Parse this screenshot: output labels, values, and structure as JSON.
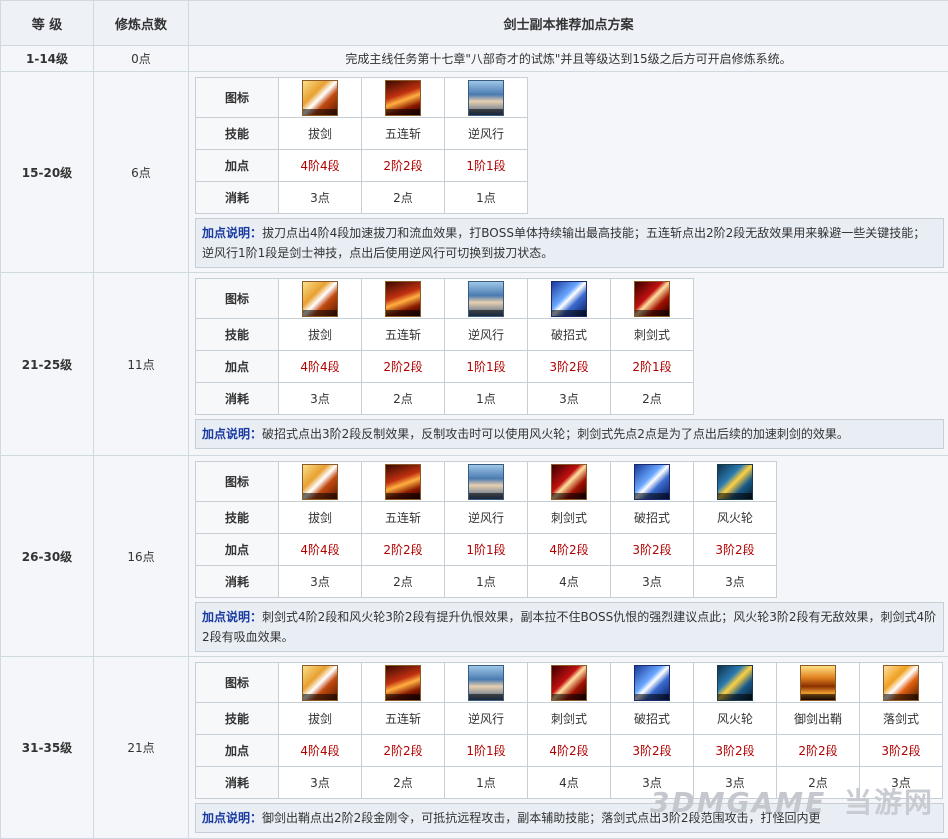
{
  "headers": {
    "level": "等 级",
    "points": "修炼点数",
    "plan": "剑士副本推荐加点方案"
  },
  "row_labels": {
    "icon": "图标",
    "skill": "技能",
    "add": "加点",
    "cost": "消耗"
  },
  "note_label": "加点说明：",
  "first_row": {
    "level": "1-14级",
    "points": "0点",
    "text": "完成主线任务第十七章\"八部奇才的试炼\"并且等级达到15级之后方可开启修炼系统。"
  },
  "sections": [
    {
      "level": "15-20级",
      "points": "6点",
      "skills": [
        {
          "icon": "sword-icon",
          "name": "拔剑",
          "add": "4阶4段",
          "cost": "3点"
        },
        {
          "icon": "combo-icon",
          "name": "五连斩",
          "add": "2阶2段",
          "cost": "2点"
        },
        {
          "icon": "wind-icon",
          "name": "逆风行",
          "add": "1阶1段",
          "cost": "1点"
        }
      ],
      "note": "拔刀点出4阶4段加速拔刀和流血效果，打BOSS单体持续输出最高技能；五连斩点出2阶2段无敌效果用来躲避一些关键技能；逆风行1阶1段是剑士神技，点出后使用逆风行可切换到拔刀状态。"
    },
    {
      "level": "21-25级",
      "points": "11点",
      "skills": [
        {
          "icon": "sword-icon",
          "name": "拔剑",
          "add": "4阶4段",
          "cost": "3点"
        },
        {
          "icon": "combo-icon",
          "name": "五连斩",
          "add": "2阶2段",
          "cost": "2点"
        },
        {
          "icon": "wind-icon",
          "name": "逆风行",
          "add": "1阶1段",
          "cost": "1点"
        },
        {
          "icon": "break-icon",
          "name": "破招式",
          "add": "3阶2段",
          "cost": "3点"
        },
        {
          "icon": "pierce-icon",
          "name": "刺剑式",
          "add": "2阶1段",
          "cost": "2点"
        }
      ],
      "note": "破招式点出3阶2段反制效果，反制攻击时可以使用风火轮；刺剑式先点2点是为了点出后续的加速刺剑的效果。"
    },
    {
      "level": "26-30级",
      "points": "16点",
      "skills": [
        {
          "icon": "sword-icon",
          "name": "拔剑",
          "add": "4阶4段",
          "cost": "3点"
        },
        {
          "icon": "combo-icon",
          "name": "五连斩",
          "add": "2阶2段",
          "cost": "2点"
        },
        {
          "icon": "wind-icon",
          "name": "逆风行",
          "add": "1阶1段",
          "cost": "1点"
        },
        {
          "icon": "pierce-icon",
          "name": "刺剑式",
          "add": "4阶2段",
          "cost": "4点"
        },
        {
          "icon": "break-icon",
          "name": "破招式",
          "add": "3阶2段",
          "cost": "3点"
        },
        {
          "icon": "wheel-icon",
          "name": "风火轮",
          "add": "3阶2段",
          "cost": "3点"
        }
      ],
      "note": "刺剑式4阶2段和风火轮3阶2段有提升仇恨效果，副本拉不住BOSS仇恨的强烈建议点此；风火轮3阶2段有无敌效果，刺剑式4阶2段有吸血效果。"
    },
    {
      "level": "31-35级",
      "points": "21点",
      "skills": [
        {
          "icon": "sword-icon",
          "name": "拔剑",
          "add": "4阶4段",
          "cost": "3点"
        },
        {
          "icon": "combo-icon",
          "name": "五连斩",
          "add": "2阶2段",
          "cost": "2点"
        },
        {
          "icon": "wind-icon",
          "name": "逆风行",
          "add": "1阶1段",
          "cost": "1点"
        },
        {
          "icon": "pierce-icon",
          "name": "刺剑式",
          "add": "4阶2段",
          "cost": "4点"
        },
        {
          "icon": "break-icon",
          "name": "破招式",
          "add": "3阶2段",
          "cost": "3点"
        },
        {
          "icon": "wheel-icon",
          "name": "风火轮",
          "add": "3阶2段",
          "cost": "3点"
        },
        {
          "icon": "guard-icon",
          "name": "御剑出鞘",
          "add": "2阶2段",
          "cost": "2点"
        },
        {
          "icon": "fall-icon",
          "name": "落剑式",
          "add": "3阶2段",
          "cost": "3点"
        }
      ],
      "note": "御剑出鞘点出2阶2段金刚令，可抵抗远程攻击，副本辅助技能；落剑式点出3阶2段范围攻击，打怪回内更"
    }
  ],
  "watermark": {
    "logo": "3DMGAME",
    "text": "当游网"
  }
}
